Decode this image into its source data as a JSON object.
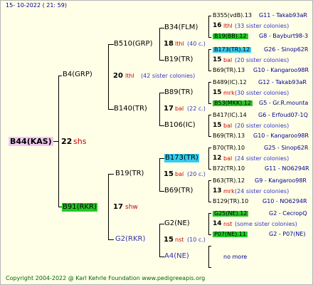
{
  "date": "15- 10-2022 ( 21: 59)",
  "copyright": "Copyright 2004-2022 @ Karl Kehrle Foundation   www.pedigreeapis.org",
  "root": {
    "id": "B44(KAS)",
    "num": "22",
    "tag": "shs"
  },
  "gen1": [
    {
      "id": "B4(GRP)",
      "num": "20",
      "tag": "lthl",
      "note": "(42 sister colonies)"
    },
    {
      "id": "B91(RKR)",
      "num": "17",
      "tag": "shw"
    }
  ],
  "gen2": [
    {
      "id": "B510(GRP)",
      "num": "18",
      "tag": "lthl",
      "note": "(40 c.)"
    },
    {
      "id": "B140(TR)",
      "num": "17",
      "tag": "bal",
      "note": "(22 c.)"
    },
    {
      "id": "B19(TR)",
      "num": "15",
      "tag": "bal",
      "note": "(20 c.)"
    },
    {
      "id": "G2(RKR)",
      "num": "15",
      "tag": "nst",
      "note": "(10 c.)"
    }
  ],
  "gen3": [
    {
      "id": "B34(FLM)"
    },
    {
      "id": "B19(TR)"
    },
    {
      "id": "B89(TR)"
    },
    {
      "id": "B106(IC)"
    },
    {
      "id": "B173(TR)"
    },
    {
      "id": "B69(TR)"
    },
    {
      "id": "G2(NE)"
    },
    {
      "id": "A4(NE)"
    }
  ],
  "gen4": [
    {
      "a": "B355(vdB).13",
      "b": "G11 - Takab93aR"
    },
    {
      "num": "16",
      "tag": "lthl",
      "note": "(33 sister colonies)"
    },
    {
      "a": "B19(BB).12",
      "b": "G8 - Bayburt98-3"
    },
    {
      "a": "B173(TR).12",
      "b": "G26 - Sinop62R"
    },
    {
      "num": "15",
      "tag": "bal",
      "note": "(20 sister colonies)"
    },
    {
      "a": "B69(TR).13",
      "b": "G10 - Kangaroo98R"
    },
    {
      "a": "B489(IC).12",
      "b": "G12 - Takab93aR"
    },
    {
      "num": "15",
      "tag": "mrk",
      "note": "(30 sister colonies)"
    },
    {
      "a": "B53(MKK).12",
      "b": "G5 - Gr.R.mounta"
    },
    {
      "a": "B417(IC).14",
      "b": "G6 - Erfoud07-1Q"
    },
    {
      "num": "15",
      "tag": "bal",
      "note": "(20 sister colonies)"
    },
    {
      "a": "B69(TR).13",
      "b": "G10 - Kangaroo98R"
    },
    {
      "a": "B70(TR).10",
      "b": "G25 - Sinop62R"
    },
    {
      "num": "12",
      "tag": "bal",
      "note": "(24 sister colonies)"
    },
    {
      "a": "B72(TR).10",
      "b": "G11 - NO6294R"
    },
    {
      "a": "B63(TR).12",
      "b": "G9 - Kangaroo98R"
    },
    {
      "num": "13",
      "tag": "mrk",
      "note": "(24 sister colonies)"
    },
    {
      "a": "B129(TR).10",
      "b": "G10 - NO6294R"
    },
    {
      "a": "G25(NE).12",
      "b": "G2 - CecropQ"
    },
    {
      "num": "14",
      "tag": "nst",
      "note": "(some sister colonies)"
    },
    {
      "a": "P07(NE).11",
      "b": "G2 - P07(NE)"
    },
    {
      "a": "no more"
    }
  ]
}
